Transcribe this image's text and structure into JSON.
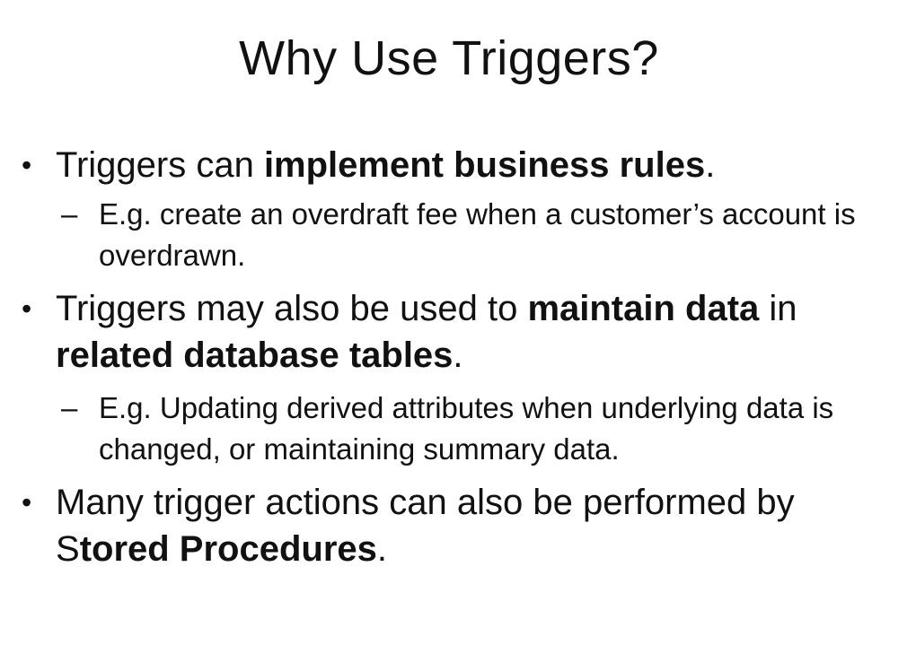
{
  "slide": {
    "title": "Why Use Triggers?"
  },
  "bullets": [
    {
      "marker": "•",
      "text_a": "Triggers can ",
      "bold_a": "implement business rules",
      "text_b": ".",
      "sub": {
        "marker": "–",
        "text": "E.g. create an overdraft fee when a customer’s account is overdrawn."
      }
    },
    {
      "marker": "•",
      "text_a": "Triggers may also be used to ",
      "bold_a": "maintain data",
      "text_b": " in ",
      "bold_b": "related database tables",
      "text_c": ".",
      "sub": {
        "marker": "–",
        "text": "E.g. Updating derived attributes when underlying data is changed, or maintaining summary data."
      }
    },
    {
      "marker": "•",
      "text_a": "Many trigger actions can also be performed by S",
      "bold_a": "tored Procedures",
      "text_b": "."
    }
  ]
}
